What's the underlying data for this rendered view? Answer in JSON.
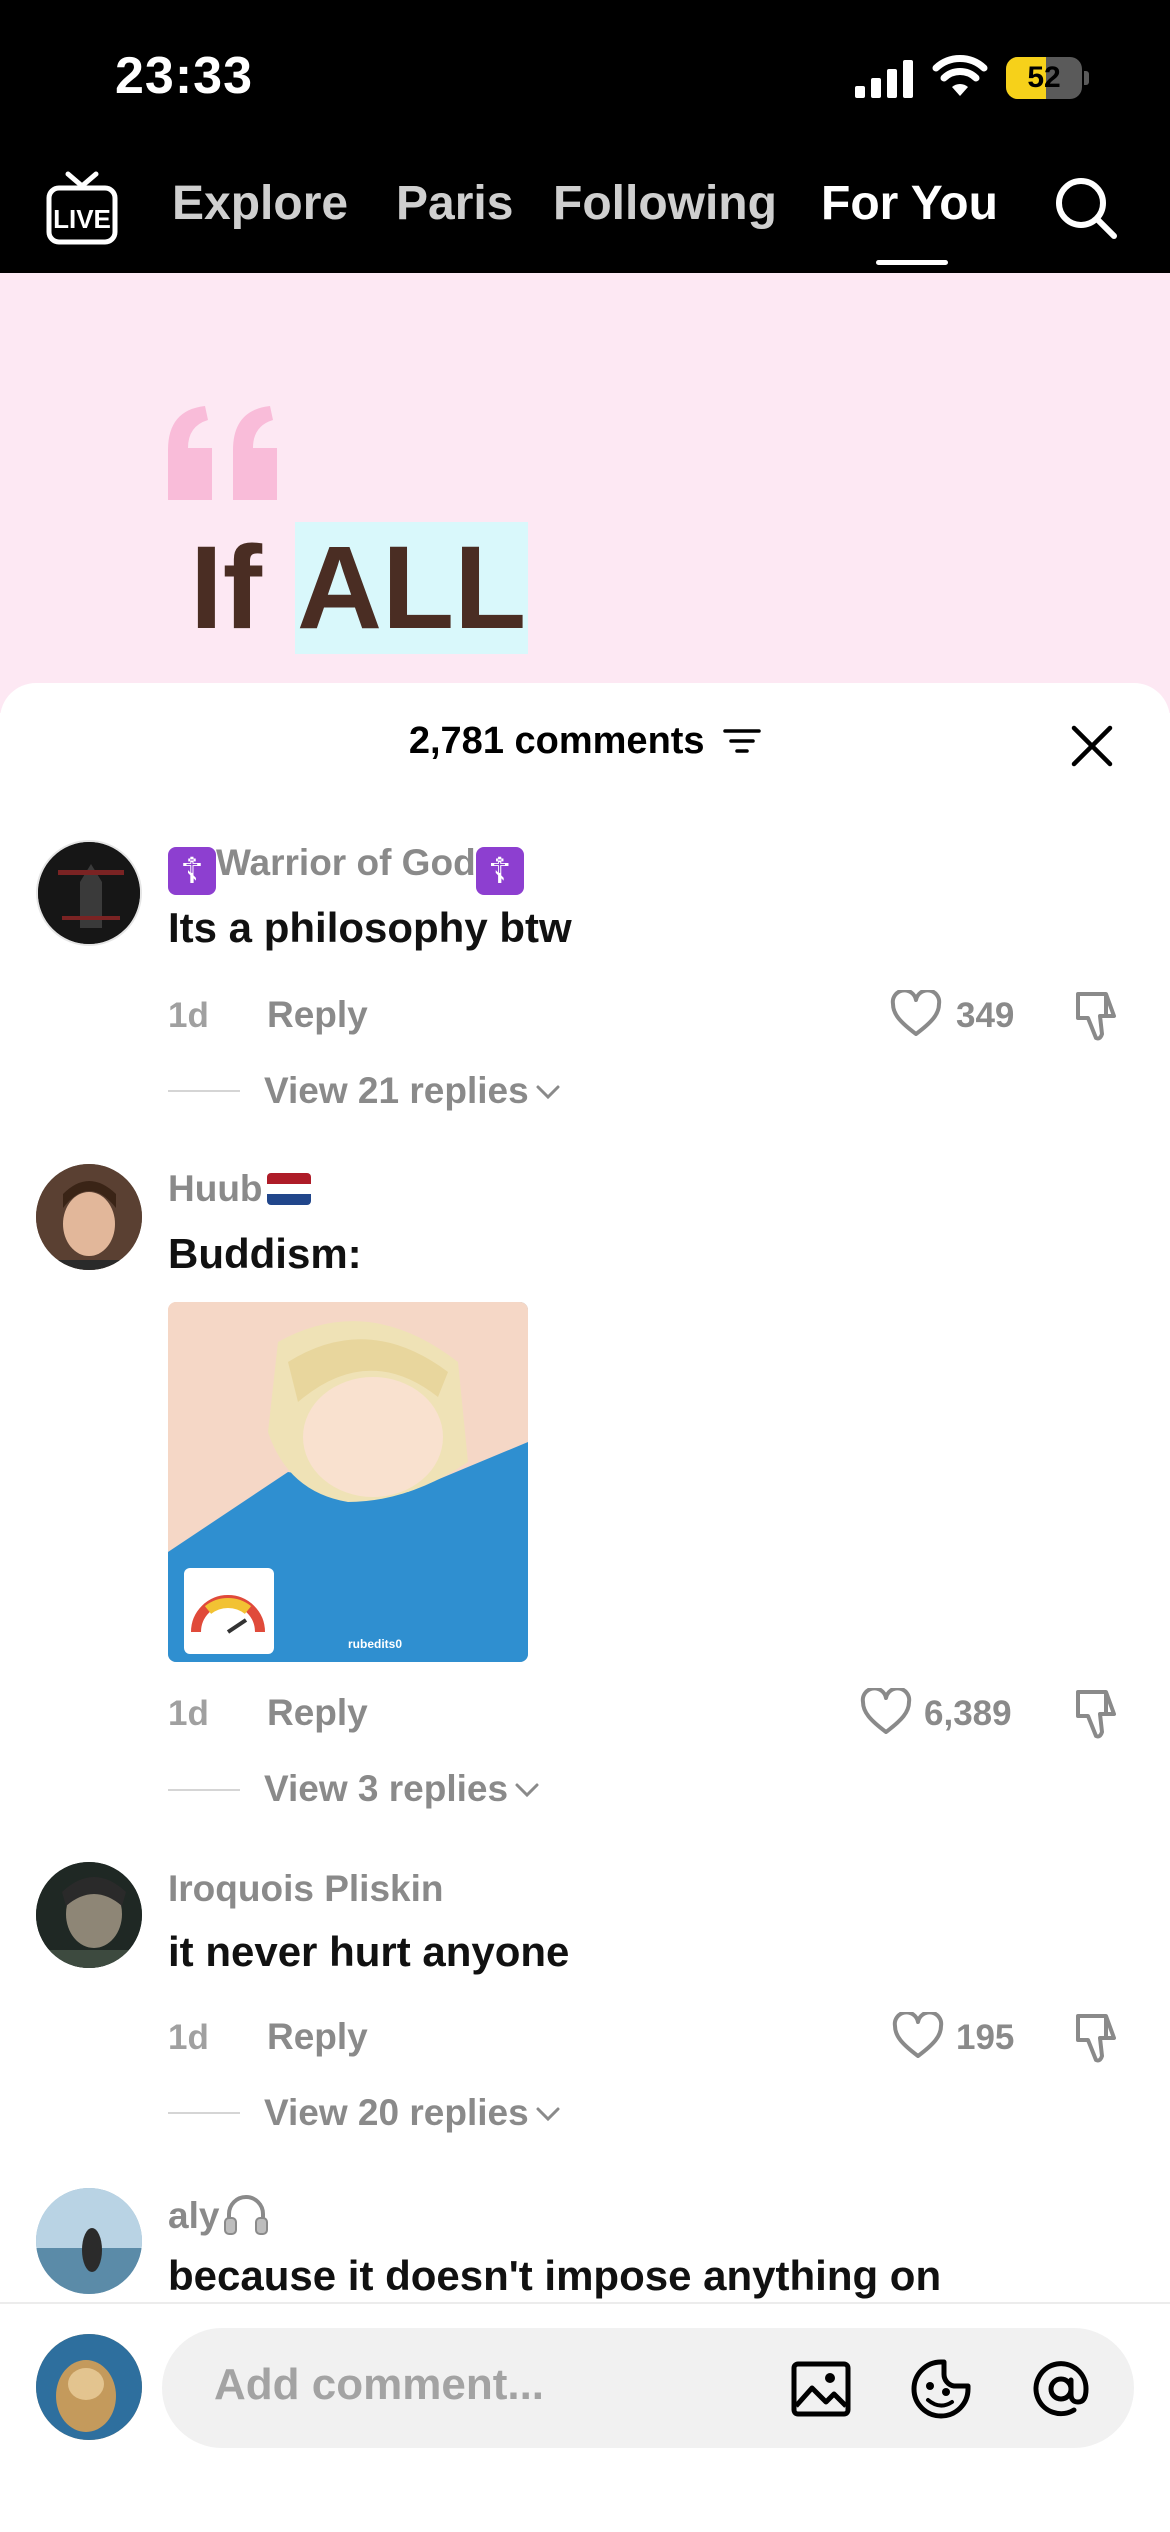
{
  "status_bar": {
    "time": "23:33",
    "battery_percent": "52",
    "battery_level": 0.52
  },
  "nav": {
    "live_label": "LIVE",
    "tabs": [
      "Explore",
      "Paris",
      "Following",
      "For You"
    ],
    "active_tab": "For You"
  },
  "video": {
    "text_plain": "If ",
    "text_highlight": "ALL"
  },
  "comments_sheet": {
    "count_label": "2,781 comments",
    "comments": [
      {
        "username": "Warrior of God",
        "text": "Its a philosophy btw",
        "time": "1d",
        "reply_label": "Reply",
        "likes": "349",
        "view_replies": "View 21 replies"
      },
      {
        "username": "Huub",
        "text": "Buddism:",
        "image_caption": "rubedits0",
        "time": "1d",
        "reply_label": "Reply",
        "likes": "6,389",
        "view_replies": "View 3 replies"
      },
      {
        "username": "Iroquois Pliskin",
        "text": "it never hurt anyone",
        "time": "1d",
        "reply_label": "Reply",
        "likes": "195",
        "view_replies": "View 20 replies"
      },
      {
        "username": "aly",
        "text": "because it doesn't impose anything on"
      }
    ]
  },
  "input_bar": {
    "placeholder": "Add comment..."
  },
  "colors": {
    "nav_bg": "#000000",
    "video_bg": "#fde8f3",
    "accent_purple": "#8d3fd0",
    "battery_yellow": "#f6d11a"
  }
}
